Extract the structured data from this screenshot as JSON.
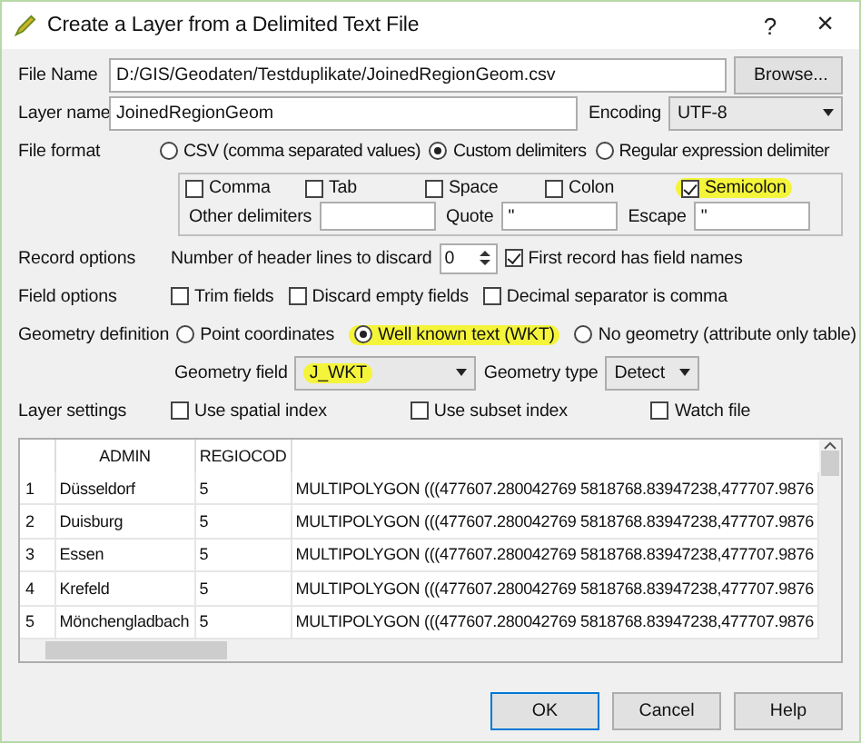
{
  "window": {
    "title": "Create a Layer from a Delimited Text File",
    "help_glyph": "?",
    "close_glyph": "×"
  },
  "file_name": {
    "label": "File Name",
    "value": "D:/GIS/Geodaten/Testduplikate/JoinedRegionGeom.csv",
    "browse": "Browse..."
  },
  "layer_name": {
    "label": "Layer name",
    "value": "JoinedRegionGeom"
  },
  "encoding": {
    "label": "Encoding",
    "value": "UTF-8"
  },
  "file_format": {
    "label": "File format",
    "options": [
      {
        "label": "CSV (comma separated values)",
        "selected": false
      },
      {
        "label": "Custom delimiters",
        "selected": true
      },
      {
        "label": "Regular expression delimiter",
        "selected": false
      }
    ]
  },
  "delimiters": [
    {
      "label": "Comma",
      "checked": false,
      "highlighted": false
    },
    {
      "label": "Tab",
      "checked": false,
      "highlighted": false
    },
    {
      "label": "Space",
      "checked": false,
      "highlighted": false
    },
    {
      "label": "Colon",
      "checked": false,
      "highlighted": false
    },
    {
      "label": "Semicolon",
      "checked": true,
      "highlighted": true
    }
  ],
  "other_delimiters": {
    "label": "Other delimiters"
  },
  "quote": {
    "label": "Quote",
    "value": "\""
  },
  "escape": {
    "label": "Escape",
    "value": "\""
  },
  "record_options": {
    "label": "Record options",
    "header_lines_label": "Number of header lines to discard",
    "header_lines": "0",
    "first_record": {
      "label": "First record has field names",
      "checked": true
    }
  },
  "field_options": {
    "label": "Field options",
    "checkboxes": [
      {
        "label": "Trim fields",
        "checked": false
      },
      {
        "label": "Discard empty fields",
        "checked": false
      },
      {
        "label": "Decimal separator is comma",
        "checked": false
      }
    ]
  },
  "geometry_definition": {
    "label": "Geometry definition",
    "options": [
      {
        "label": "Point coordinates",
        "selected": false,
        "highlighted": false
      },
      {
        "label": "Well known text (WKT)",
        "selected": true,
        "highlighted": true
      },
      {
        "label": "No geometry (attribute only table)",
        "selected": false,
        "highlighted": false
      }
    ]
  },
  "geometry_field": {
    "label": "Geometry field",
    "value": "J_WKT",
    "highlighted": true
  },
  "geometry_type": {
    "label": "Geometry type",
    "value": "Detect"
  },
  "layer_settings": {
    "label": "Layer settings",
    "checkboxes": [
      {
        "label": "Use spatial index",
        "checked": false
      },
      {
        "label": "Use subset index",
        "checked": false
      },
      {
        "label": "Watch file",
        "checked": false
      }
    ]
  },
  "table": {
    "columns": [
      "ADMIN",
      "REGIOCOD"
    ],
    "rows": [
      {
        "number": "1",
        "cells": [
          "Düsseldorf",
          "5",
          "MULTIPOLYGON (((477607.280042769 5818768.83947238,477707.9876"
        ]
      },
      {
        "number": "2",
        "cells": [
          "Duisburg",
          "5",
          "MULTIPOLYGON (((477607.280042769 5818768.83947238,477707.9876"
        ]
      },
      {
        "number": "3",
        "cells": [
          "Essen",
          "5",
          "MULTIPOLYGON (((477607.280042769 5818768.83947238,477707.9876"
        ]
      },
      {
        "number": "4",
        "cells": [
          "Krefeld",
          "5",
          "MULTIPOLYGON (((477607.280042769 5818768.83947238,477707.9876"
        ]
      },
      {
        "number": "5",
        "cells": [
          "Mönchengladbach",
          "5",
          "MULTIPOLYGON (((477607.280042769 5818768.83947238,477707.9876"
        ]
      }
    ]
  },
  "buttons": [
    {
      "label": "OK",
      "default": true
    },
    {
      "label": "Cancel",
      "default": false
    },
    {
      "label": "Help",
      "default": false
    }
  ]
}
